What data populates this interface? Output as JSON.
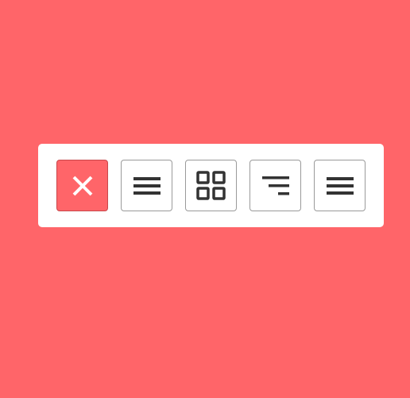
{
  "colors": {
    "background": "#ff6569",
    "toolbar": "#ffffff",
    "active_button": "#ff6569",
    "icon": "#333333",
    "active_icon": "#ffffff"
  },
  "toolbar": {
    "buttons": [
      {
        "icon": "close-icon",
        "active": true
      },
      {
        "icon": "hamburger-menu-icon",
        "active": false
      },
      {
        "icon": "grid-icon",
        "active": false
      },
      {
        "icon": "align-right-icon",
        "active": false
      },
      {
        "icon": "hamburger-menu-icon",
        "active": false
      }
    ]
  }
}
